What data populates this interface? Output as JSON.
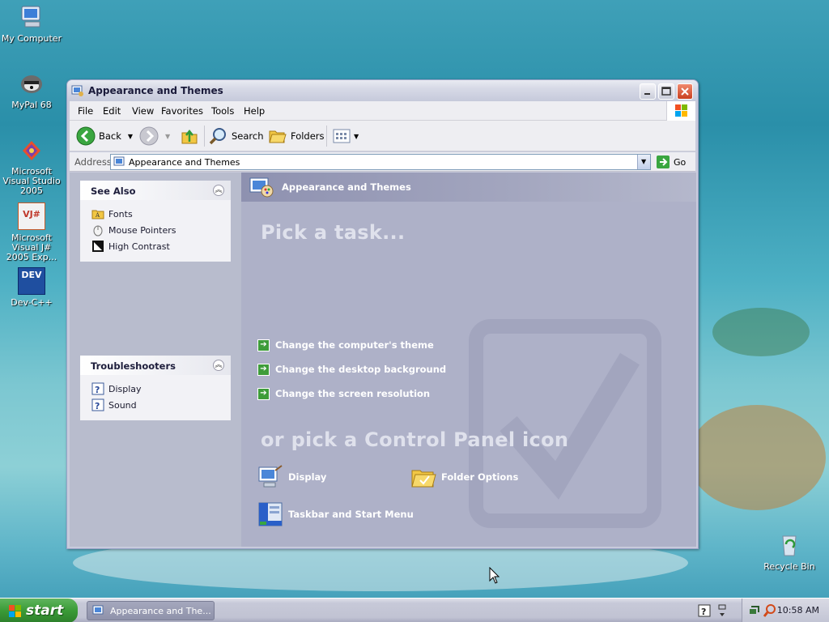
{
  "desktop": {
    "icons": [
      {
        "label": "My Computer",
        "icon": "my-computer-icon"
      },
      {
        "label": "MyPal 68",
        "icon": "mypal-icon"
      },
      {
        "label": "Microsoft Visual Studio 2005",
        "icon": "visual-studio-icon"
      },
      {
        "label": "Microsoft Visual J# 2005 Exp...",
        "icon": "visual-jsharp-icon"
      },
      {
        "label": "Dev-C++",
        "icon": "devcpp-icon"
      },
      {
        "label": "Recycle Bin",
        "icon": "recycle-bin-icon"
      }
    ],
    "devcpp_badge": "DEV",
    "vj_badge": "VJ#"
  },
  "window": {
    "title": "Appearance and Themes",
    "menu": [
      "File",
      "Edit",
      "View",
      "Favorites",
      "Tools",
      "Help"
    ],
    "toolbar": {
      "back": "Back",
      "search": "Search",
      "folders": "Folders"
    },
    "address": {
      "label": "Address",
      "value": "Appearance and Themes",
      "go": "Go"
    }
  },
  "sidebar": {
    "see_also": {
      "title": "See Also",
      "items": [
        "Fonts",
        "Mouse Pointers",
        "High Contrast"
      ]
    },
    "troubleshooters": {
      "title": "Troubleshooters",
      "items": [
        "Display",
        "Sound"
      ]
    }
  },
  "main": {
    "header": "Appearance and Themes",
    "pick_task": "Pick a task...",
    "tasks": [
      "Change the computer's theme",
      "Change the desktop background",
      "Change the screen resolution"
    ],
    "pick_icon": "or pick a Control Panel icon",
    "icons": [
      "Display",
      "Folder Options",
      "Taskbar and Start Menu"
    ]
  },
  "taskbar": {
    "start": "start",
    "active_window": "Appearance and The...",
    "clock": "10:58 AM"
  }
}
